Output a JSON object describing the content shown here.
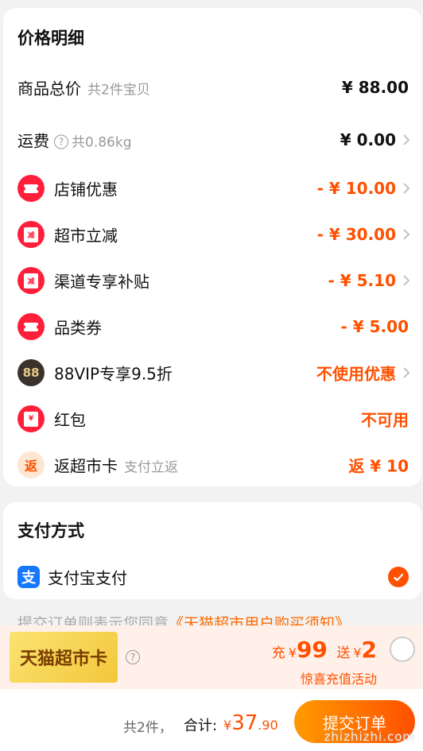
{
  "price_details": {
    "title": "价格明细",
    "total": {
      "label": "商品总价",
      "sub": "共2件宝贝",
      "value": "¥ 88.00"
    },
    "shipping": {
      "label": "运费",
      "sub": "共0.86kg",
      "value": "¥ 0.00"
    },
    "discounts": [
      {
        "label": "店铺优惠",
        "value": "- ¥ 10.00",
        "icon": "ticket-icon"
      },
      {
        "label": "超市立减",
        "value": "- ¥ 30.00",
        "icon": "envelope-icon",
        "icon_char": "减"
      },
      {
        "label": "渠道专享补贴",
        "value": "- ¥ 5.10",
        "icon": "envelope-icon",
        "icon_char": "减"
      },
      {
        "label": "品类券",
        "value": "- ¥ 5.00",
        "icon": "ticket-icon"
      },
      {
        "label": "88VIP专享9.5折",
        "value": "不使用优惠",
        "icon": "vip88-icon",
        "icon_char": "88"
      },
      {
        "label": "红包",
        "value": "不可用",
        "icon": "envelope-icon",
        "icon_char": "¥"
      },
      {
        "label": "返超市卡",
        "sub": "支付立返",
        "value": "返 ¥ 10",
        "icon": "rebate-icon",
        "icon_char": "返"
      }
    ]
  },
  "payment": {
    "title": "支付方式",
    "method": {
      "label": "支付宝支付",
      "icon_char": "支",
      "selected": true
    }
  },
  "agreement": {
    "prefix": "提交订单则表示您同意",
    "link": "《天猫超市用户购买须知》"
  },
  "promo": {
    "badge": "天猫超市卡",
    "charge_prefix": "充",
    "charge_yen": "¥",
    "charge_amount": "99",
    "gift_prefix": "送",
    "gift_yen": "¥",
    "gift_amount": "2",
    "subtitle": "惊喜充值活动"
  },
  "footer": {
    "count": "共2件，",
    "total_label": "合计:",
    "total_yen": "¥",
    "total_int": "37",
    "total_dec": ".90",
    "submit": "提交订单",
    "watermark": "zhizhizhi.com"
  },
  "colors": {
    "accent": "#ff5000",
    "red_icon": "#ff1f3a",
    "alipay": "#1677ff"
  }
}
